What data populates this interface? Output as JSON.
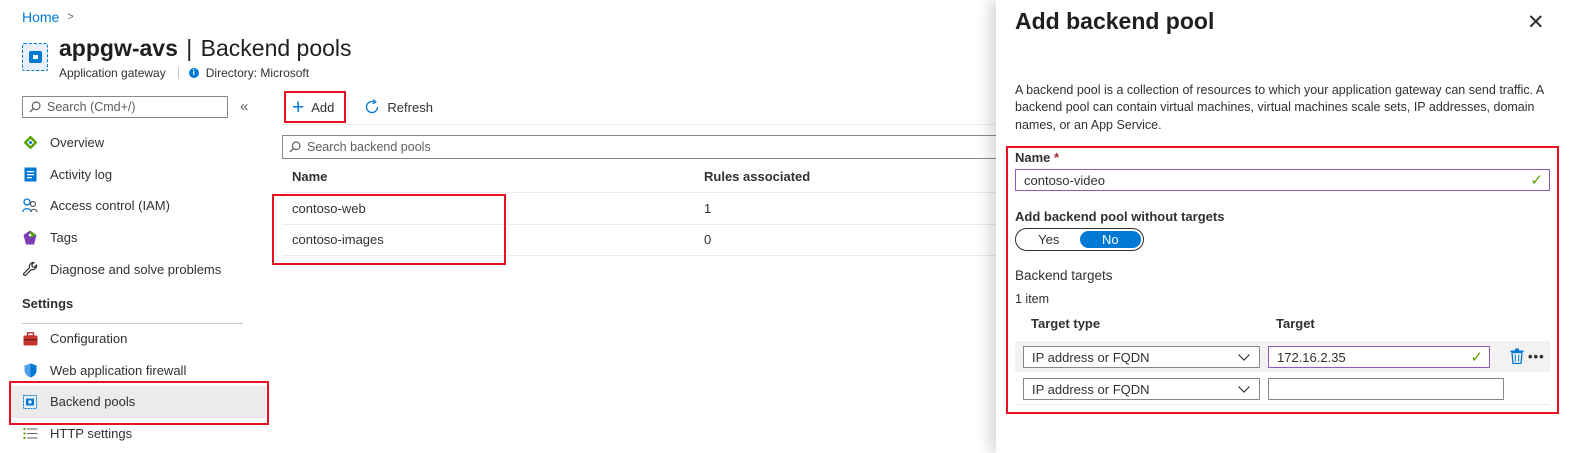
{
  "breadcrumb": {
    "home": "Home",
    "separator": ">"
  },
  "header": {
    "resource_name": "appgw-avs",
    "separator": "|",
    "page_name": "Backend pools",
    "resource_type": "Application gateway",
    "directory": "Directory: Microsoft"
  },
  "sidebar": {
    "search_placeholder": "Search (Cmd+/)",
    "collapse_glyph": "«",
    "items_top": [
      {
        "label": "Overview",
        "icon": "overview-icon"
      },
      {
        "label": "Activity log",
        "icon": "activity-log-icon"
      },
      {
        "label": "Access control (IAM)",
        "icon": "people-icon"
      },
      {
        "label": "Tags",
        "icon": "tag-icon"
      },
      {
        "label": "Diagnose and solve problems",
        "icon": "wrench-icon"
      }
    ],
    "section_settings": "Settings",
    "items_settings": [
      {
        "label": "Configuration",
        "icon": "toolbox-icon"
      },
      {
        "label": "Web application firewall",
        "icon": "shield-icon"
      },
      {
        "label": "Backend pools",
        "icon": "backend-pool-icon",
        "selected": true
      },
      {
        "label": "HTTP settings",
        "icon": "list-icon"
      }
    ]
  },
  "toolbar": {
    "add_label": "Add",
    "refresh_label": "Refresh"
  },
  "pools": {
    "search_placeholder": "Search backend pools",
    "columns": [
      "Name",
      "Rules associated"
    ],
    "rows": [
      {
        "name": "contoso-web",
        "rules": "1"
      },
      {
        "name": "contoso-images",
        "rules": "0"
      }
    ]
  },
  "panel": {
    "title": "Add backend pool",
    "close_glyph": "✕",
    "description": "A backend pool is a collection of resources to which your application gateway can send traffic. A backend pool can contain virtual machines, virtual machines scale sets, IP addresses, domain names, or an App Service.",
    "name_label": "Name",
    "required_mark": "*",
    "name_value": "contoso-video",
    "without_targets_label": "Add backend pool without targets",
    "toggle": {
      "yes": "Yes",
      "no": "No",
      "selected": "No"
    },
    "backend_targets_label": "Backend targets",
    "item_count": "1 item",
    "target_columns": [
      "Target type",
      "Target"
    ],
    "targets": [
      {
        "type": "IP address or FQDN",
        "target": "172.16.2.35"
      },
      {
        "type": "IP address or FQDN",
        "target": ""
      }
    ],
    "more_glyph": "•••"
  },
  "colors": {
    "accent": "#0078d4",
    "highlight": "#e81123",
    "valid_check": "#57a300",
    "input_focus": "#8a5bc1"
  }
}
